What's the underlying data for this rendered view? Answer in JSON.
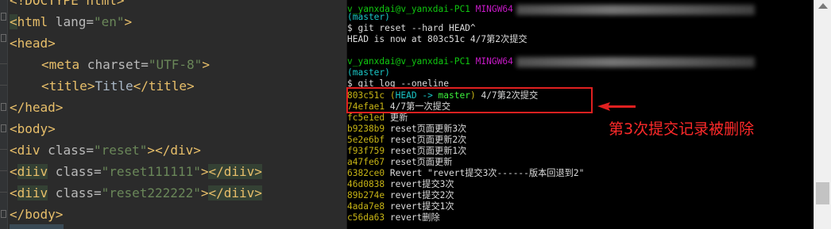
{
  "editor": {
    "lines": [
      {
        "open": "<!DOCTYPE ",
        "name": "html",
        "close": ">"
      },
      {
        "open": "<",
        "name": "html",
        "attr": " lang=",
        "val": "\"en\"",
        "close": ">"
      },
      {
        "open": "<",
        "name": "head",
        "close": ">"
      },
      {
        "open": "<",
        "name": "meta",
        "attr": " charset=",
        "val": "\"UTF-8\"",
        "close": ">"
      },
      {
        "open": "<",
        "name": "title",
        "close": ">",
        "text": "Title",
        "end": "</title>"
      },
      {
        "open": "</",
        "name": "head",
        "close": ">"
      },
      {
        "open": "<",
        "name": "body",
        "close": ">"
      },
      {
        "open": "<",
        "name": "div",
        "attr": " class=",
        "val": "\"reset\"",
        "close": ">",
        "end": "</div>"
      },
      {
        "open": "<",
        "name": "diiv",
        "attr": " class=",
        "val": "\"reset111111\"",
        "close": ">",
        "end": "</diiv>"
      },
      {
        "open": "<",
        "name": "diiv",
        "attr": " class=",
        "val": "\"reset222222\"",
        "close": ">",
        "end": "</diiv>"
      },
      {
        "open": "</",
        "name": "body",
        "close": ">"
      }
    ]
  },
  "terminal": {
    "prompt1": {
      "user": "v_yanxdai@v_yanxdai-PC1",
      "shell": "MINGW64",
      "branch": "(master)"
    },
    "cmd1": "$ git reset --hard HEAD^",
    "out1": "HEAD is now at 803c51c 4/7第2次提交",
    "prompt2": {
      "user": "v_yanxdai@v_yanxdai-PC1",
      "shell": "MINGW64",
      "branch": "(master)"
    },
    "cmd2": "$ git log --oneline",
    "head_commit": {
      "hash": "803c51c",
      "ref_open": "(",
      "ref_head": "HEAD -> ",
      "ref_branch": "master",
      "ref_close": ")",
      "msg": " 4/7第2次提交"
    },
    "commits": [
      {
        "hash": "74efae1",
        "msg": " 4/7第一次提交"
      },
      {
        "hash": "fc5e1ed",
        "msg": " 更新"
      },
      {
        "hash": "b9238b9",
        "msg": " reset页面更新3次"
      },
      {
        "hash": "5e2e6bf",
        "msg": " reset页面更新2次"
      },
      {
        "hash": "f93f759",
        "msg": " reset页面更新1次"
      },
      {
        "hash": "a47fe67",
        "msg": " reset页面更新"
      },
      {
        "hash": "6382ce0",
        "msg": " Revert \"revert提交3次------版本回退到2\""
      },
      {
        "hash": "46d0838",
        "msg": " revert提交3次"
      },
      {
        "hash": "89b274e",
        "msg": " revert提交2次"
      },
      {
        "hash": "4ada7e8",
        "msg": " revert提交1次"
      },
      {
        "hash": "c56da63",
        "msg": " revert删除"
      }
    ]
  },
  "annotation": "第3次提交记录被删除",
  "colors": {
    "annotation": "#ff2a2a",
    "hash": "#c7b415",
    "prompt_user": "#10c810",
    "prompt_shell": "#c71ac7"
  }
}
